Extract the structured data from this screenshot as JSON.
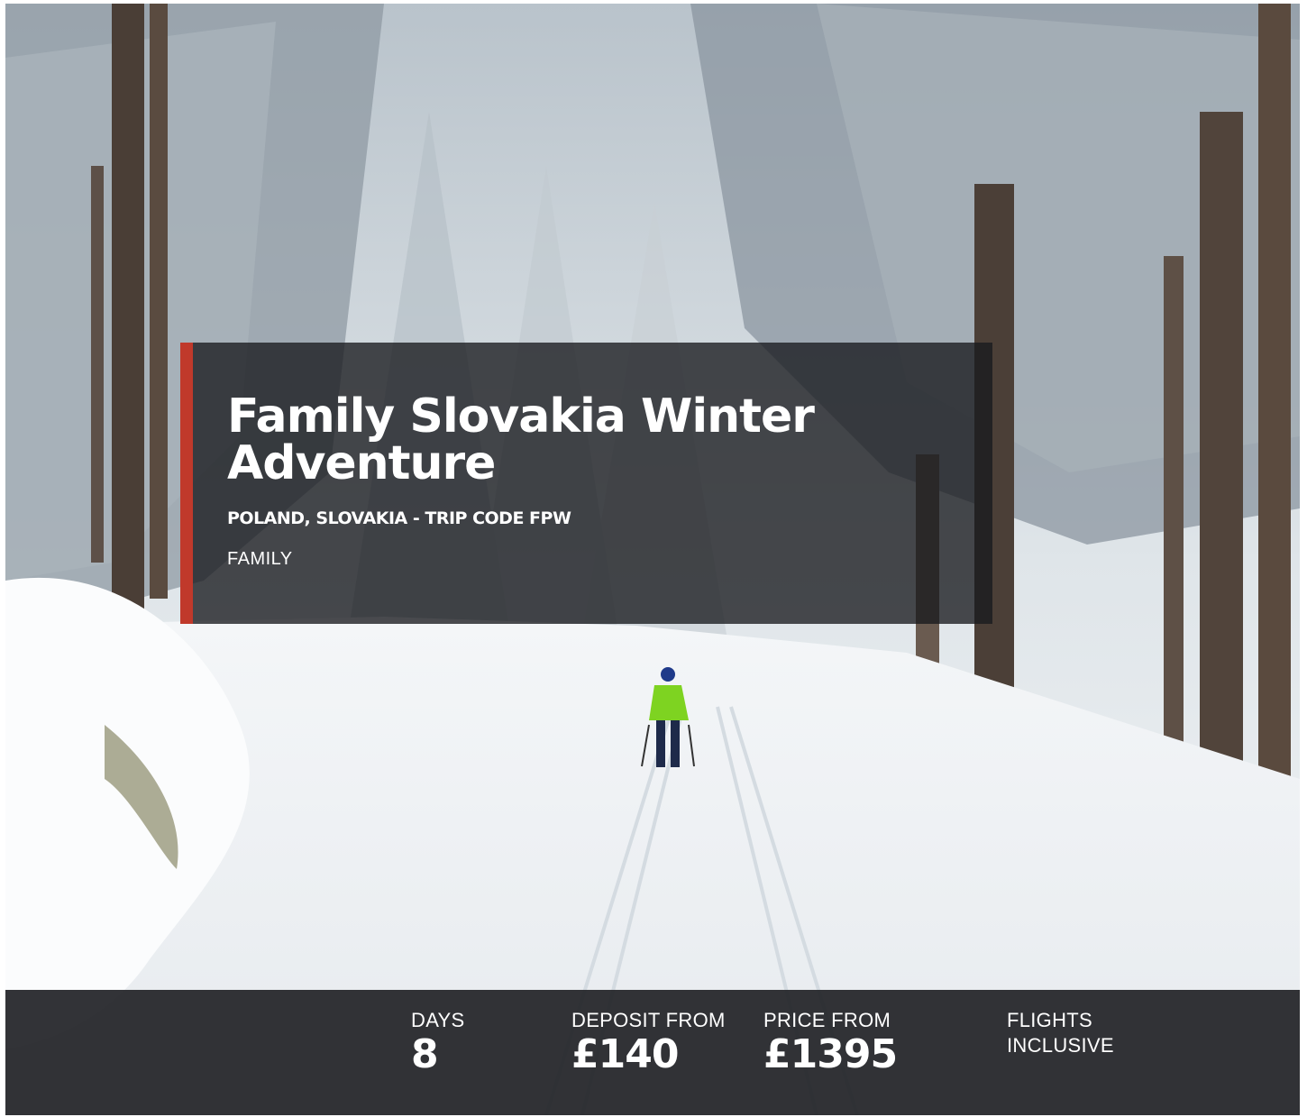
{
  "trip": {
    "title": "Family Slovakia Winter Adventure",
    "subtitle": "POLAND, SLOVAKIA - TRIP CODE FPW",
    "category": "FAMILY"
  },
  "stats": {
    "days_label": "DAYS",
    "days_value": "8",
    "deposit_label": "DEPOSIT FROM",
    "deposit_value": "£140",
    "price_label": "PRICE FROM",
    "price_value": "£1395",
    "flights_label": "FLIGHTS INCLUSIVE"
  },
  "colors": {
    "accent": "#c0392b",
    "panel": "#181a1e",
    "stats_bar": "#222428"
  },
  "hero_image": {
    "icon": "snowy-forest-skier-photo"
  }
}
